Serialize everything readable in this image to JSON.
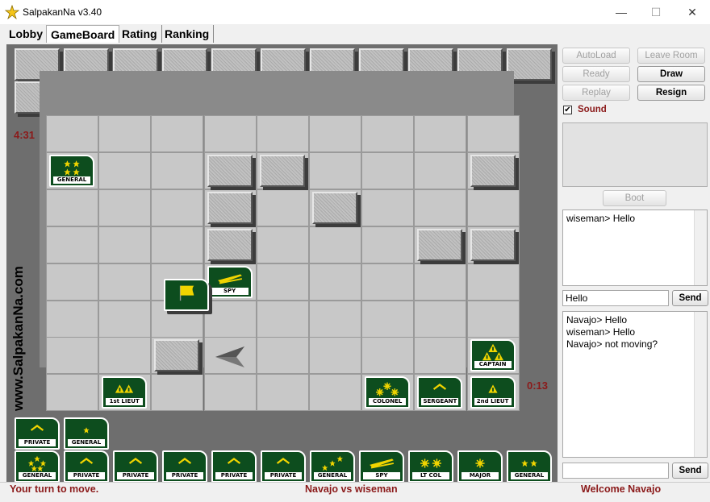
{
  "window": {
    "title": "SalpakanNa v3.40",
    "minimize": "—",
    "maximize": "☐",
    "close": "✕"
  },
  "tabs": [
    {
      "label": "Lobby"
    },
    {
      "label": "GameBoard",
      "active": true
    },
    {
      "label": "Rating"
    },
    {
      "label": "Ranking"
    }
  ],
  "timers": {
    "opponent": "4:31",
    "player": "0:13"
  },
  "watermark": "www.SalpakanNa.com",
  "buttons": {
    "autoload": "AutoLoad",
    "leave_room": "Leave Room",
    "ready": "Ready",
    "draw": "Draw",
    "replay": "Replay",
    "resign": "Resign",
    "boot": "Boot"
  },
  "sound": {
    "label": "Sound",
    "checked": true
  },
  "room_chat": {
    "lines": [
      "wiseman> Hello"
    ]
  },
  "room_input": {
    "value": "Hello",
    "send": "Send"
  },
  "game_chat": {
    "lines": [
      "Navajo> Hello",
      "wiseman> Hello",
      "Navajo> not moving?"
    ]
  },
  "game_input": {
    "value": "",
    "send": "Send"
  },
  "board": {
    "own_pieces": [
      {
        "rank": "GENERAL",
        "insignia": "stars4"
      },
      {
        "rank": "SPY",
        "insignia": "spy"
      },
      {
        "rank": "CAPTAIN",
        "insignia": "tri3"
      },
      {
        "rank": "1st LIEUT",
        "insignia": "tri2"
      },
      {
        "rank": "COLONEL",
        "insignia": "sun3"
      },
      {
        "rank": "SERGEANT",
        "insignia": "chev"
      },
      {
        "rank": "2nd LIEUT",
        "insignia": "tri1"
      }
    ]
  },
  "captured_row1": [
    "PRIVATE",
    "GENERAL"
  ],
  "captured_row2": [
    "GENERAL",
    "PRIVATE",
    "PRIVATE",
    "PRIVATE",
    "PRIVATE",
    "PRIVATE",
    "GENERAL",
    "SPY",
    "LT COL",
    "MAJOR",
    "GENERAL"
  ],
  "status": {
    "left": "Your turn to move.",
    "center": "Navajo vs wiseman",
    "right": "Welcome Navajo"
  }
}
